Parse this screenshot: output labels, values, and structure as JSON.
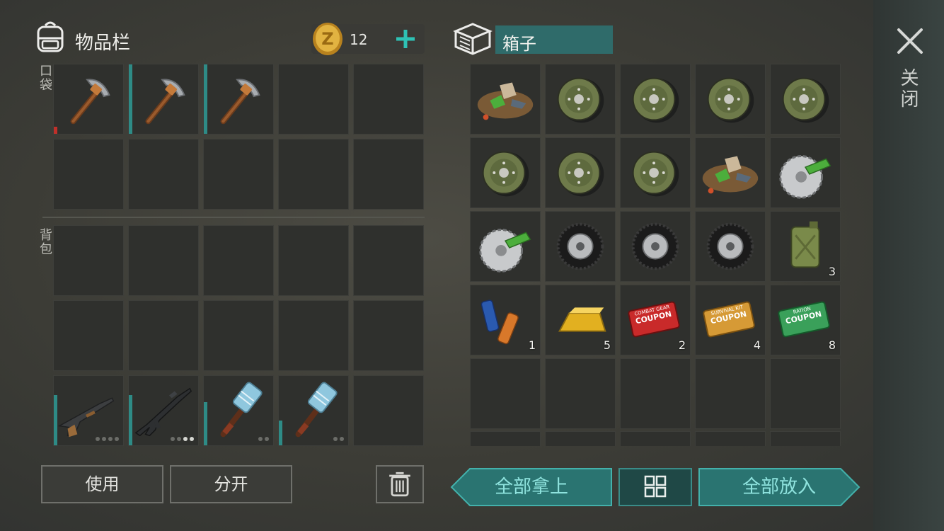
{
  "inventory": {
    "title": "物品栏",
    "coins": "12",
    "pockets_label": "口袋",
    "backpack_label": "背包",
    "pockets": [
      {
        "item": "pickaxe",
        "durability": 0.1,
        "durability_color": "#c0302a"
      },
      {
        "item": "pickaxe",
        "durability": 1.0,
        "durability_color": "#2e8b86"
      },
      {
        "item": "pickaxe",
        "durability": 1.0,
        "durability_color": "#2e8b86"
      },
      {
        "item": ""
      },
      {
        "item": ""
      },
      {
        "item": ""
      },
      {
        "item": ""
      },
      {
        "item": ""
      },
      {
        "item": ""
      },
      {
        "item": ""
      }
    ],
    "backpack": [
      {
        "item": ""
      },
      {
        "item": ""
      },
      {
        "item": ""
      },
      {
        "item": ""
      },
      {
        "item": ""
      },
      {
        "item": ""
      },
      {
        "item": ""
      },
      {
        "item": ""
      },
      {
        "item": ""
      },
      {
        "item": ""
      },
      {
        "item": "shotgun",
        "durability": 0.72,
        "durability_color": "#2e8b86",
        "ammo_total": 4,
        "ammo_loaded": 0
      },
      {
        "item": "assault-rifle",
        "durability": 0.72,
        "durability_color": "#2e8b86",
        "ammo_total": 4,
        "ammo_loaded": 2
      },
      {
        "item": "sledgehammer",
        "durability": 0.62,
        "durability_color": "#2e8b86",
        "ammo_total": 2,
        "ammo_loaded": 0
      },
      {
        "item": "sledgehammer",
        "durability": 0.36,
        "durability_color": "#2e8b86",
        "ammo_total": 2,
        "ammo_loaded": 0
      },
      {
        "item": ""
      }
    ]
  },
  "container": {
    "name": "箱子",
    "slots": [
      {
        "item": "scrap-pile",
        "qty": ""
      },
      {
        "item": "wheel-hub",
        "qty": ""
      },
      {
        "item": "wheel-hub",
        "qty": ""
      },
      {
        "item": "wheel-hub",
        "qty": ""
      },
      {
        "item": "wheel-hub",
        "qty": ""
      },
      {
        "item": "wheel-hub",
        "qty": ""
      },
      {
        "item": "wheel-hub",
        "qty": ""
      },
      {
        "item": "wheel-hub",
        "qty": ""
      },
      {
        "item": "scrap-pile",
        "qty": ""
      },
      {
        "item": "saw-blade",
        "qty": ""
      },
      {
        "item": "saw-blade",
        "qty": ""
      },
      {
        "item": "tire",
        "qty": ""
      },
      {
        "item": "tire",
        "qty": ""
      },
      {
        "item": "tire",
        "qty": ""
      },
      {
        "item": "jerry-can",
        "qty": "3"
      },
      {
        "item": "batteries",
        "qty": "1"
      },
      {
        "item": "gold-bar",
        "qty": "5"
      },
      {
        "item": "coupon-red",
        "qty": "2",
        "coupon_text": "COUPON",
        "coupon_sub": "COMBAT GEAR"
      },
      {
        "item": "coupon-orange",
        "qty": "4",
        "coupon_text": "COUPON",
        "coupon_sub": "SURVIVAL KIT"
      },
      {
        "item": "coupon-green",
        "qty": "8",
        "coupon_text": "COUPON",
        "coupon_sub": "RATION"
      },
      {
        "item": ""
      },
      {
        "item": ""
      },
      {
        "item": ""
      },
      {
        "item": ""
      },
      {
        "item": ""
      }
    ]
  },
  "buttons": {
    "use": "使用",
    "split": "分开",
    "take_all": "全部拿上",
    "put_all": "全部放入"
  },
  "close_label": "关闭",
  "colors": {
    "accent": "#2f6b6a",
    "accent_text": "#8fe3de",
    "plus": "#2ec2b5"
  }
}
